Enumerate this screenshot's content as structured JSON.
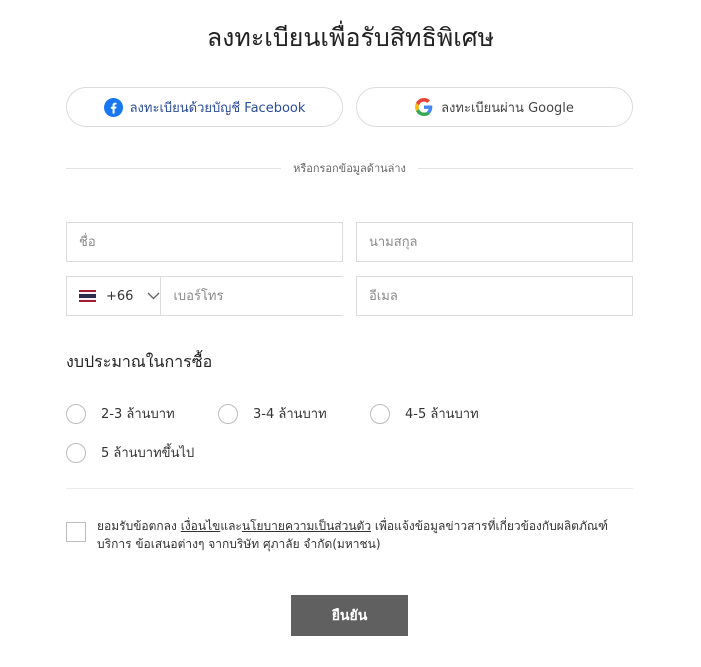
{
  "title": "ลงทะเบียนเพื่อรับสิทธิพิเศษ",
  "social": {
    "facebook_label": "ลงทะเบียนด้วยบัญชี Facebook",
    "google_label": "ลงทะเบียนผ่าน Google"
  },
  "divider_text": "หรือกรอกข้อมูลด้านล่าง",
  "form": {
    "first_name_placeholder": "ชื่อ",
    "last_name_placeholder": "นามสกุล",
    "country_code": "+66",
    "phone_placeholder": "เบอร์โทร",
    "email_placeholder": "อีเมล"
  },
  "budget": {
    "title": "งบประมาณในการซื้อ",
    "options": [
      "2-3 ล้านบาท",
      "3-4 ล้านบาท",
      "4-5 ล้านบาท",
      "5 ล้านบาทขึ้นไป"
    ]
  },
  "consent": {
    "prefix": "ยอมรับข้อตกลง ",
    "terms_link": "เงื่อนไข",
    "and": "และ",
    "privacy_link": "นโยบายความเป็นส่วนตัว",
    "suffix": " เพื่อแจ้งข้อมูลข่าวสารที่เกี่ยวข้องกับผลิตภัณฑ์ บริการ ข้อเสนอต่างๆ จากบริษัท ศุภาลัย จำกัด(มหาชน)"
  },
  "submit_label": "ยืนยัน",
  "colors": {
    "facebook_blue": "#1877f2",
    "submit_bg": "#606060",
    "border": "#dcdcdc"
  }
}
